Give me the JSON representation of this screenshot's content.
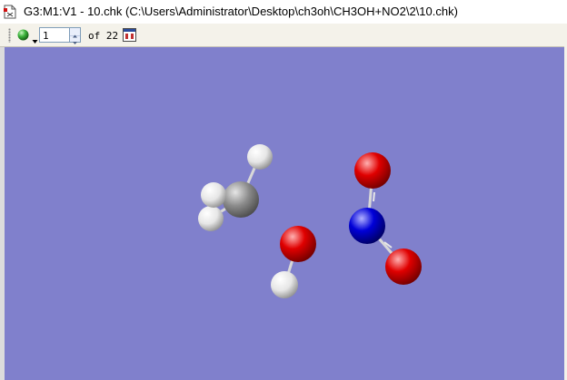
{
  "window": {
    "title": "G3:M1:V1 - 10.chk (C:\\Users\\Administrator\\Desktop\\ch3oh\\CH3OH+NO2\\2\\10.chk)"
  },
  "toolbar": {
    "frame_value": "1",
    "frame_total_label": "of 22"
  },
  "colors": {
    "viewport_background": "#8080cc",
    "carbon": "#8c8c8c",
    "hydrogen": "#e6e6e6",
    "oxygen": "#e00000",
    "nitrogen": "#0000d8",
    "status_ball": "#3cb43c"
  },
  "icons": [
    "app-document-icon",
    "status-ball-icon",
    "dropdown-arrow-icon",
    "spin-up-icon",
    "spin-down-icon",
    "movie-animation-icon"
  ]
}
